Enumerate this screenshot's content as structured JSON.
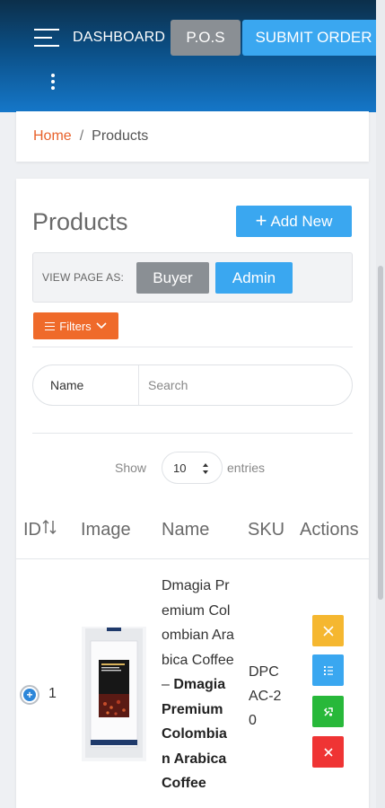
{
  "header": {
    "dashboard_label": "DASHBOARD",
    "pos_label": "P.O.S",
    "submit_label": "SUBMIT ORDER"
  },
  "breadcrumb": {
    "home": "Home",
    "separator": "/",
    "current": "Products"
  },
  "main": {
    "title": "Products",
    "add_new_label": "Add New",
    "view_page_as": {
      "label": "VIEW PAGE AS:",
      "buyer": "Buyer",
      "admin": "Admin"
    },
    "filters_label": "Filters",
    "search": {
      "field_label": "Name",
      "placeholder": "Search"
    },
    "show": {
      "prefix": "Show",
      "value": "10",
      "suffix": "entries"
    }
  },
  "table": {
    "columns": [
      "ID",
      "Image",
      "Name",
      "SKU",
      "Actions"
    ],
    "rows": [
      {
        "id": "1",
        "name_plain": "Dmagia Premium Colombian Arabica Coffee – ",
        "name_bold": "Dmagia Premium Colombian Arabica Coffee",
        "sku": "DPCAC-20"
      }
    ]
  },
  "colors": {
    "accent_blue": "#3aa7f0",
    "orange": "#ef6a2a",
    "gray_button": "#8a8f94",
    "edit": "#f5b730",
    "delete": "#ef3434",
    "build": "#28b83a"
  },
  "icons": [
    "menu-icon",
    "more-vertical-icon",
    "plus-icon",
    "filter-lines-icon",
    "chevron-down-icon",
    "sort-icon",
    "expand-row-icon",
    "edit-icon",
    "list-icon",
    "build-icon",
    "delete-icon"
  ]
}
